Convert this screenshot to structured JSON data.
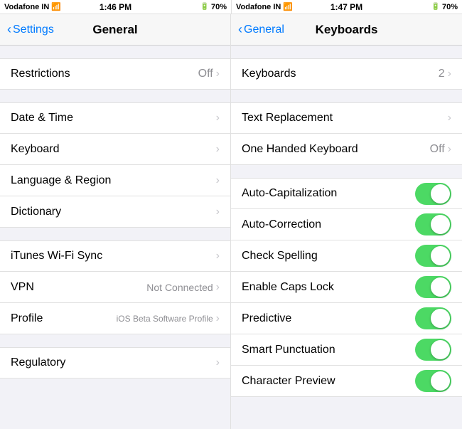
{
  "leftPanel": {
    "statusBar": {
      "carrier": "Vodafone IN",
      "time": "1:46 PM",
      "battery": "70%"
    },
    "navTitle": "General",
    "navBack": "Settings",
    "sections": [
      {
        "cells": [
          {
            "label": "Restrictions",
            "value": "Off",
            "hasChevron": true
          }
        ]
      },
      {
        "cells": [
          {
            "label": "Date & Time",
            "value": "",
            "hasChevron": true
          },
          {
            "label": "Keyboard",
            "value": "",
            "hasChevron": true
          },
          {
            "label": "Language & Region",
            "value": "",
            "hasChevron": true
          },
          {
            "label": "Dictionary",
            "value": "",
            "hasChevron": true
          }
        ]
      },
      {
        "cells": [
          {
            "label": "iTunes Wi-Fi Sync",
            "value": "",
            "hasChevron": true
          },
          {
            "label": "VPN",
            "value": "Not Connected",
            "hasChevron": true
          },
          {
            "label": "Profile",
            "value": "iOS Beta Software Profile",
            "hasChevron": true
          }
        ]
      },
      {
        "cells": [
          {
            "label": "Regulatory",
            "value": "",
            "hasChevron": true
          }
        ]
      }
    ]
  },
  "rightPanel": {
    "statusBar": {
      "carrier": "Vodafone IN",
      "time": "1:47 PM",
      "battery": "70%"
    },
    "navTitle": "Keyboards",
    "navBack": "General",
    "sections": [
      {
        "cells": [
          {
            "label": "Keyboards",
            "value": "2",
            "hasChevron": true,
            "toggle": false
          }
        ]
      },
      {
        "cells": [
          {
            "label": "Text Replacement",
            "value": "",
            "hasChevron": true,
            "toggle": false
          },
          {
            "label": "One Handed Keyboard",
            "value": "Off",
            "hasChevron": true,
            "toggle": false
          }
        ]
      },
      {
        "cells": [
          {
            "label": "Auto-Capitalization",
            "value": "",
            "hasChevron": false,
            "toggle": true
          },
          {
            "label": "Auto-Correction",
            "value": "",
            "hasChevron": false,
            "toggle": true
          },
          {
            "label": "Check Spelling",
            "value": "",
            "hasChevron": false,
            "toggle": true
          },
          {
            "label": "Enable Caps Lock",
            "value": "",
            "hasChevron": false,
            "toggle": true
          },
          {
            "label": "Predictive",
            "value": "",
            "hasChevron": false,
            "toggle": true
          },
          {
            "label": "Smart Punctuation",
            "value": "",
            "hasChevron": false,
            "toggle": true
          },
          {
            "label": "Character Preview",
            "value": "",
            "hasChevron": false,
            "toggle": true
          }
        ]
      }
    ]
  }
}
